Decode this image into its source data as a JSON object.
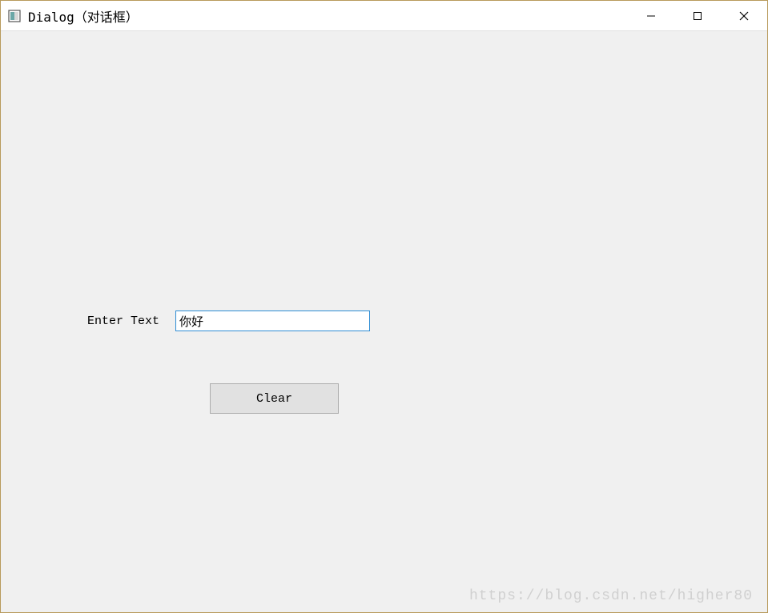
{
  "window": {
    "title": "Dialog（对话框）"
  },
  "form": {
    "label": "Enter Text",
    "input_value": "你好",
    "clear_button_label": "Clear"
  },
  "watermark": "https://blog.csdn.net/higher80"
}
